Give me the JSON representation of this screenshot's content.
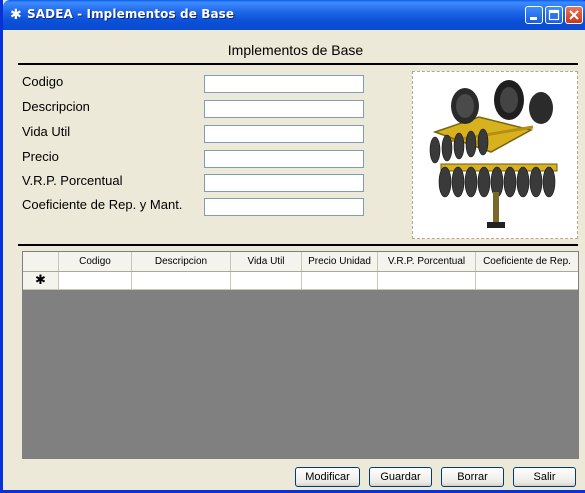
{
  "window": {
    "title": "SADEA - Implementos de Base",
    "title_icon": "asterisk-icon",
    "controls": [
      "minimize-icon",
      "maximize-icon",
      "close-icon"
    ]
  },
  "section_title": "Implementos de Base",
  "form": {
    "fields": [
      {
        "label": "Codigo",
        "value": ""
      },
      {
        "label": "Descripcion",
        "value": ""
      },
      {
        "label": "Vida Util",
        "value": ""
      },
      {
        "label": "Precio",
        "value": ""
      },
      {
        "label": "V.R.P. Porcentual",
        "value": ""
      },
      {
        "label": "Coeficiente de Rep. y Mant.",
        "value": ""
      }
    ]
  },
  "picture": {
    "icon": "disc-harrow-implement-image"
  },
  "grid": {
    "columns": [
      "Codigo",
      "Descripcion",
      "Vida Util",
      "Precio Unidad",
      "V.R.P. Porcentual",
      "Coeficiente de Rep."
    ],
    "new_row_marker": "✱"
  },
  "buttons": {
    "modificar": "Modificar",
    "guardar": "Guardar",
    "borrar": "Borrar",
    "salir": "Salir"
  },
  "colors": {
    "title_bar": "#0b50d8",
    "background": "#ece9d8",
    "grid_background": "#808080",
    "implement_yellow": "#d7b21e"
  }
}
